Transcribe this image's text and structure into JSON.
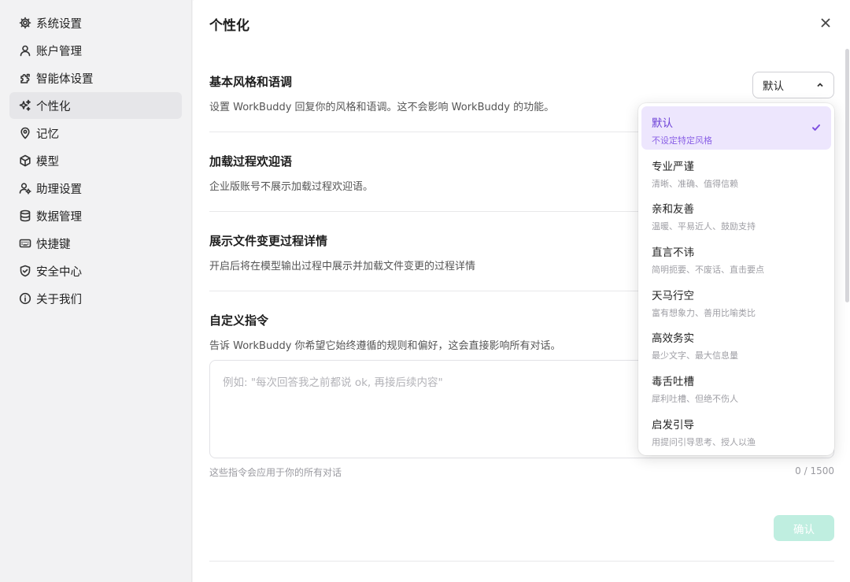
{
  "sidebar": {
    "items": [
      {
        "label": "系统设置",
        "icon": "gear-icon"
      },
      {
        "label": "账户管理",
        "icon": "user-icon"
      },
      {
        "label": "智能体设置",
        "icon": "puzzle-icon"
      },
      {
        "label": "个性化",
        "icon": "sparkle-icon",
        "active": true
      },
      {
        "label": "记忆",
        "icon": "location-pin-icon"
      },
      {
        "label": "模型",
        "icon": "cube-icon"
      },
      {
        "label": "助理设置",
        "icon": "user-gear-icon"
      },
      {
        "label": "数据管理",
        "icon": "database-icon"
      },
      {
        "label": "快捷键",
        "icon": "keyboard-icon"
      },
      {
        "label": "安全中心",
        "icon": "shield-icon"
      },
      {
        "label": "关于我们",
        "icon": "info-icon"
      }
    ]
  },
  "main": {
    "title": "个性化",
    "sections": {
      "style": {
        "title": "基本风格和语调",
        "desc": "设置 WorkBuddy 回复你的风格和语调。这不会影响 WorkBuddy 的功能。",
        "select_value": "默认"
      },
      "greeting": {
        "title": "加载过程欢迎语",
        "desc": "企业版账号不展示加载过程欢迎语。"
      },
      "file_changes": {
        "title": "展示文件变更过程详情",
        "desc": "开启后将在模型输出过程中展示并加载文件变更的过程详情"
      },
      "custom": {
        "title": "自定义指令",
        "desc": "告诉 WorkBuddy 你希望它始终遵循的规则和偏好，这会直接影响所有对话。",
        "placeholder": "例如: \"每次回答我之前都说 ok, 再接后续内容\"",
        "hint": "这些指令会应用于你的所有对话",
        "counter": "0 / 1500",
        "confirm_label": "确认"
      }
    }
  },
  "dropdown": {
    "options": [
      {
        "label": "默认",
        "desc": "不设定特定风格",
        "selected": true
      },
      {
        "label": "专业严谨",
        "desc": "清晰、准确、值得信赖"
      },
      {
        "label": "亲和友善",
        "desc": "温暖、平易近人、鼓励支持"
      },
      {
        "label": "直言不讳",
        "desc": "简明扼要、不废话、直击要点"
      },
      {
        "label": "天马行空",
        "desc": "富有想象力、善用比喻类比"
      },
      {
        "label": "高效务实",
        "desc": "最少文字、最大信息量"
      },
      {
        "label": "毒舌吐槽",
        "desc": "犀利吐槽、但绝不伤人"
      },
      {
        "label": "启发引导",
        "desc": "用提问引导思考、授人以渔"
      }
    ]
  },
  "colors": {
    "accent": "#7d4fe0",
    "selected_bg": "#ede6fd",
    "confirm_disabled": "#bfeee0"
  }
}
